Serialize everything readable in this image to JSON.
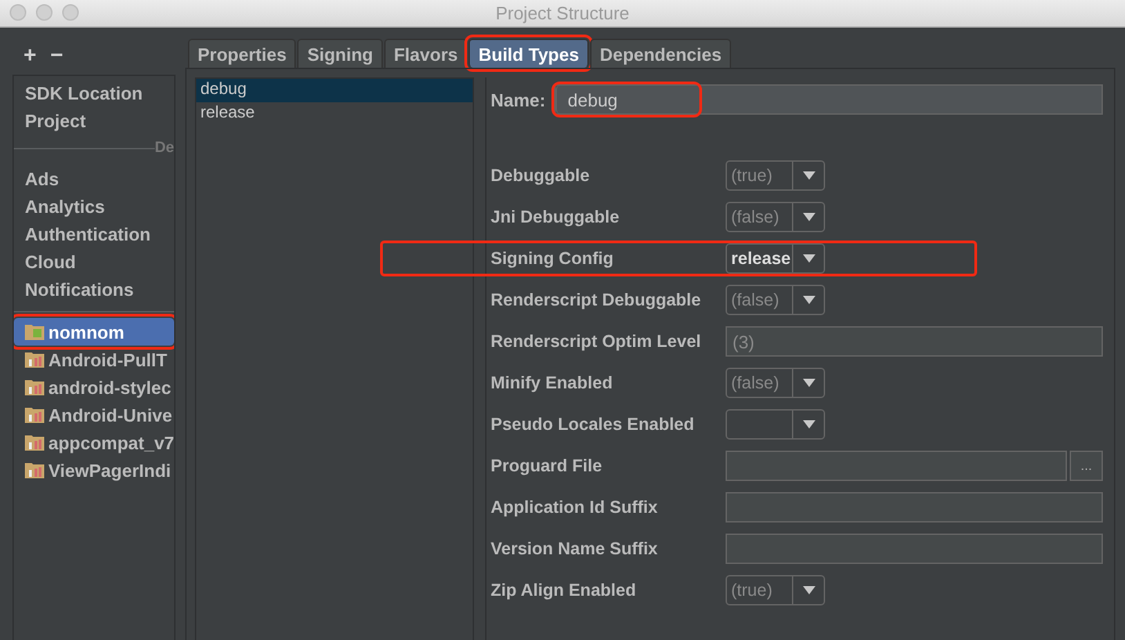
{
  "window": {
    "title": "Project Structure"
  },
  "toolbar": {
    "add": "+",
    "remove": "−"
  },
  "sidebar": {
    "groups": [
      {
        "items": [
          {
            "label": "SDK Location",
            "selected": false,
            "highlighted": false
          },
          {
            "label": "Project",
            "selected": false,
            "highlighted": false
          }
        ]
      },
      {
        "divider_label": "De",
        "items": [
          {
            "label": "Ads",
            "selected": false,
            "highlighted": false
          },
          {
            "label": "Analytics",
            "selected": false,
            "highlighted": false
          },
          {
            "label": "Authentication",
            "selected": false,
            "highlighted": false
          },
          {
            "label": "Cloud",
            "selected": false,
            "highlighted": false
          },
          {
            "label": "Notifications",
            "selected": false,
            "highlighted": false
          }
        ]
      },
      {
        "items": [
          {
            "label": "nomnom",
            "selected": true,
            "highlighted": true,
            "kind": "app"
          },
          {
            "label": "Android-PullT",
            "selected": false,
            "highlighted": false,
            "kind": "library"
          },
          {
            "label": "android-stylec",
            "selected": false,
            "highlighted": false,
            "kind": "library"
          },
          {
            "label": "Android-Unive",
            "selected": false,
            "highlighted": false,
            "kind": "library"
          },
          {
            "label": "appcompat_v7",
            "selected": false,
            "highlighted": false,
            "kind": "library"
          },
          {
            "label": "ViewPagerIndi",
            "selected": false,
            "highlighted": false,
            "kind": "library"
          }
        ]
      }
    ]
  },
  "tabs": [
    {
      "label": "Properties",
      "selected": false,
      "highlighted": false
    },
    {
      "label": "Signing",
      "selected": false,
      "highlighted": false
    },
    {
      "label": "Flavors",
      "selected": false,
      "highlighted": false
    },
    {
      "label": "Build Types",
      "selected": true,
      "highlighted": true
    },
    {
      "label": "Dependencies",
      "selected": false,
      "highlighted": false
    }
  ],
  "build_types": [
    {
      "label": "debug",
      "selected": true
    },
    {
      "label": "release",
      "selected": false
    }
  ],
  "name_field": {
    "label": "Name:",
    "value": "debug",
    "highlighted": true
  },
  "fields": [
    {
      "kind": "dropdown",
      "label": "Debuggable",
      "value": "(true)",
      "default": true,
      "highlighted": false
    },
    {
      "kind": "dropdown",
      "label": "Jni Debuggable",
      "value": "(false)",
      "default": true,
      "highlighted": false
    },
    {
      "kind": "dropdown",
      "label": "Signing Config",
      "value": "release",
      "default": false,
      "highlighted": true
    },
    {
      "kind": "dropdown",
      "label": "Renderscript Debuggable",
      "value": "(false)",
      "default": true,
      "highlighted": false
    },
    {
      "kind": "text",
      "label": "Renderscript Optim Level",
      "value": "(3)",
      "default": true,
      "highlighted": false
    },
    {
      "kind": "dropdown",
      "label": "Minify Enabled",
      "value": "(false)",
      "default": true,
      "highlighted": false
    },
    {
      "kind": "dropdown",
      "label": "Pseudo Locales Enabled",
      "highlighted": false
    },
    {
      "kind": "file",
      "label": "Proguard File",
      "button": "...",
      "highlighted": false
    },
    {
      "kind": "text",
      "label": "Application Id Suffix",
      "highlighted": false
    },
    {
      "kind": "text",
      "label": "Version Name Suffix",
      "highlighted": false
    },
    {
      "kind": "dropdown",
      "label": "Zip Align Enabled",
      "value": "(true)",
      "default": true,
      "highlighted": false
    }
  ]
}
